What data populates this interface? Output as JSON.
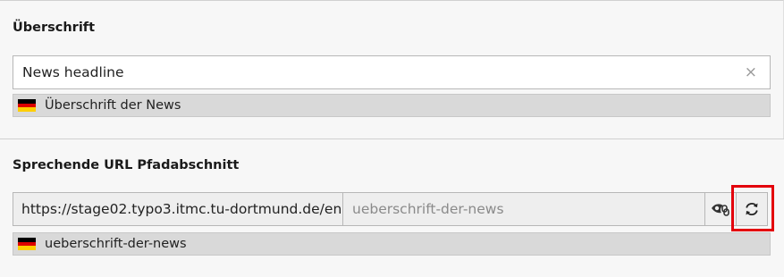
{
  "headline_section": {
    "label": "Überschrift",
    "input_value": "News headline",
    "clear_icon": "×",
    "translation": {
      "flag": "de-flag-icon",
      "text": "Überschrift der News"
    }
  },
  "slug_section": {
    "label": "Sprechende URL Pfadabschnitt",
    "prefix": "https://stage02.typo3.itmc.tu-dortmund.de/en",
    "value": "ueberschrift-der-news",
    "toggle_icon": "eye-link-icon",
    "recalculate_icon": "refresh-icon",
    "translation": {
      "flag": "de-flag-icon",
      "text": "ueberschrift-der-news"
    }
  },
  "colors": {
    "highlight": "#e3000b",
    "flag_black": "#000000",
    "flag_red": "#dd0000",
    "flag_gold": "#ffce00"
  }
}
